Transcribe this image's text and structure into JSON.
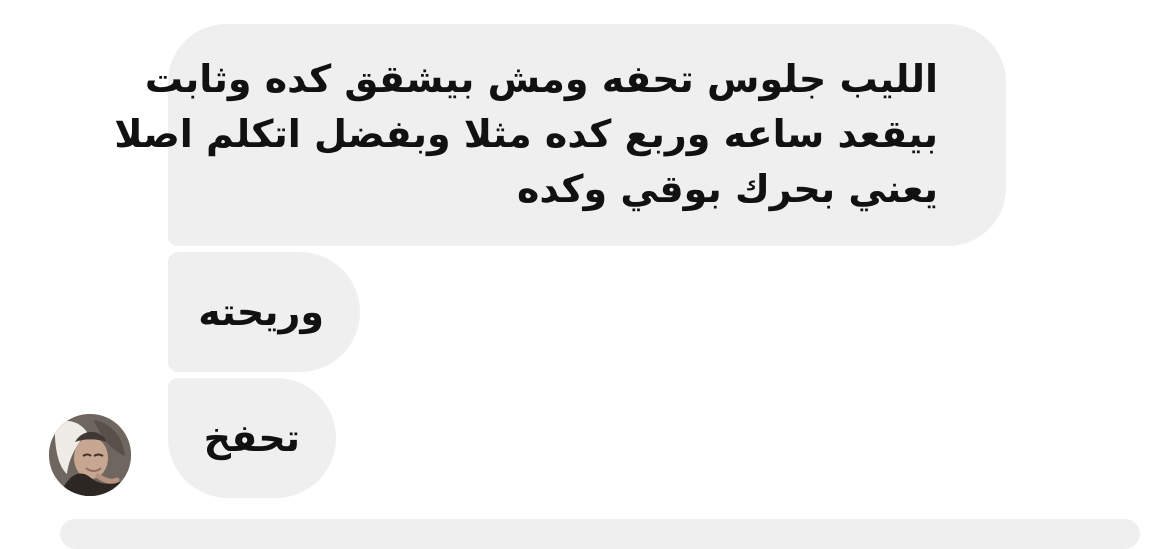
{
  "chat": {
    "messages": [
      {
        "lines": [
          "الليب جلوس تحفه ومش بيشقق كده وثابت",
          "بيقعد ساعه وربع كده مثلا وبفضل اتكلم اصلا",
          "يعني بحرك بوقي وكده"
        ]
      },
      {
        "text": "وريحته"
      },
      {
        "text": "تحفخ"
      }
    ]
  },
  "colors": {
    "bubble_bg": "#efefef",
    "text": "#111111",
    "background": "#ffffff"
  },
  "icons": {
    "avatar": "profile-avatar-icon"
  }
}
